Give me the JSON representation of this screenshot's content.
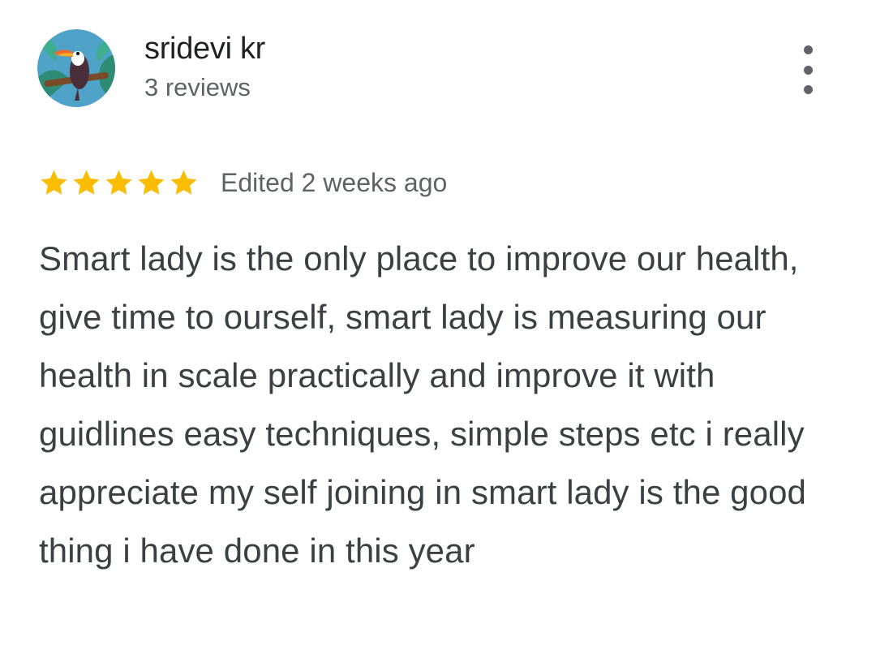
{
  "review": {
    "author_name": "sridevi kr",
    "author_reviews": "3 reviews",
    "rating": 5,
    "rating_max": 5,
    "edited_label": "Edited 2 weeks ago",
    "text": "Smart lady is the only place to improve our health, give time to ourself, smart lady is measuring our health in scale practically and improve it with guidlines easy techniques, simple steps etc i really appreciate my self joining in smart lady is the good thing i have done in this year"
  },
  "icons": {
    "avatar": "toucan-avatar-icon",
    "menu": "more-vert-icon",
    "star": "star-icon"
  },
  "colors": {
    "star": "#fbbc04",
    "name": "#202124",
    "secondary": "#5f6368",
    "body": "#3c4043"
  }
}
